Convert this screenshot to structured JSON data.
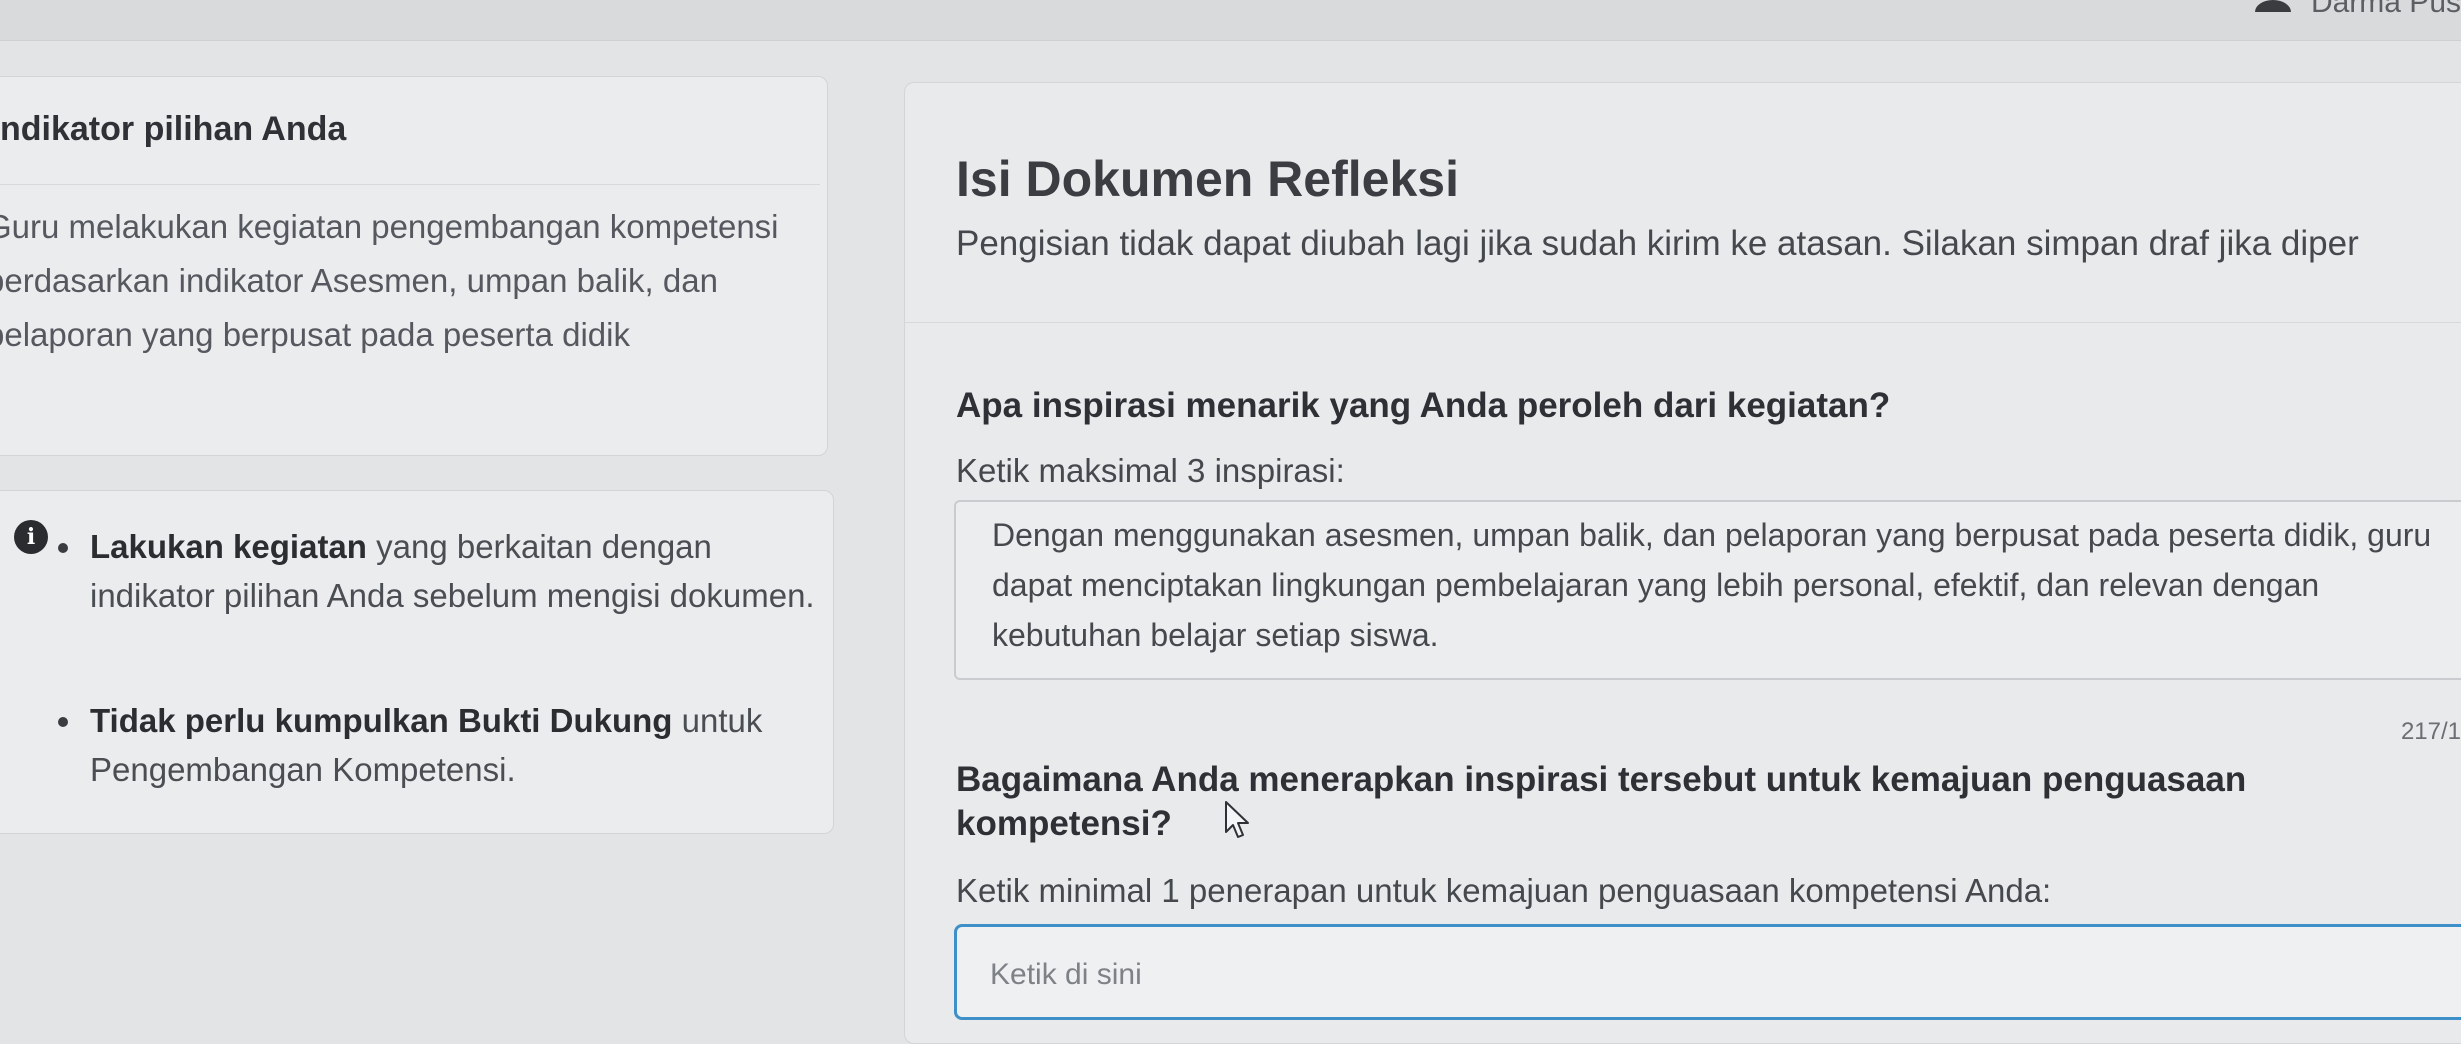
{
  "header": {
    "user_name": "Darma Pus"
  },
  "indicator_card": {
    "title": "ndikator pilihan Anda",
    "text": "Guru melakukan kegiatan pengembangan kompetensi berdasarkan indikator Asesmen, umpan balik, dan pelaporan yang berpusat pada peserta didik"
  },
  "info_card": {
    "bullet1_bold": "Lakukan kegiatan",
    "bullet1_rest": " yang berkaitan dengan indikator pilihan Anda sebelum mengisi dokumen.",
    "bullet2_bold": "Tidak perlu kumpulkan Bukti Dukung",
    "bullet2_rest": " untuk Pengembangan Kompetensi."
  },
  "document": {
    "title": "Isi Dokumen Refleksi",
    "subtitle": "Pengisian tidak dapat diubah lagi jika sudah kirim ke atasan. Silakan simpan draf jika diper",
    "question1": "Apa inspirasi menarik yang Anda peroleh dari kegiatan?",
    "hint1": "Ketik maksimal 3 inspirasi:",
    "answer1": "Dengan menggunakan asesmen, umpan balik, dan pelaporan yang berpusat pada peserta didik, guru dapat menciptakan lingkungan pembelajaran yang lebih personal, efektif, dan relevan dengan kebutuhan belajar setiap siswa.",
    "counter1": "217/1",
    "question2": "Bagaimana Anda menerapkan inspirasi tersebut untuk kemajuan penguasaan kompetensi?",
    "hint2": "Ketik minimal 1 penerapan untuk kemajuan penguasaan kompetensi Anda:",
    "input2_placeholder": "Ketik di sini"
  },
  "icons": {
    "user": "user-icon",
    "info": "info-icon",
    "cursor": "mouse-cursor-icon"
  }
}
